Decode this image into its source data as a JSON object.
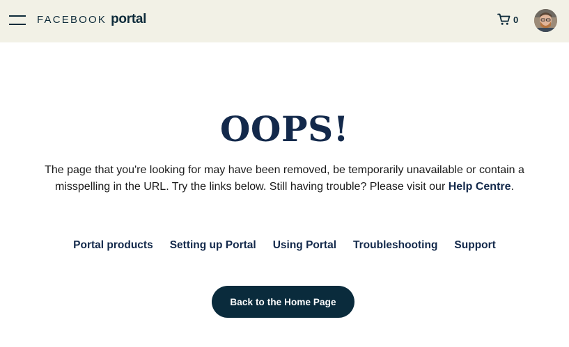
{
  "header": {
    "logo_facebook": "FACEBOOK",
    "logo_portal": "portal",
    "cart_count": "0",
    "menu_icon": "hamburger-menu-icon",
    "cart_icon": "shopping-cart-icon"
  },
  "main": {
    "title": "OOPS!",
    "message_text": "The page that you're looking for may have been removed, be temporarily unavailable or contain a misspelling in the URL. Try the links below. Still having trouble? Please visit our ",
    "help_link": "Help Centre",
    "message_end": ".",
    "links": [
      "Portal products",
      "Setting up Portal",
      "Using Portal",
      "Troubleshooting",
      "Support"
    ],
    "home_button": "Back to the Home Page"
  },
  "colors": {
    "header_bg": "#f2f1e6",
    "heading": "#13294b",
    "button_bg": "#0a2b3c"
  }
}
